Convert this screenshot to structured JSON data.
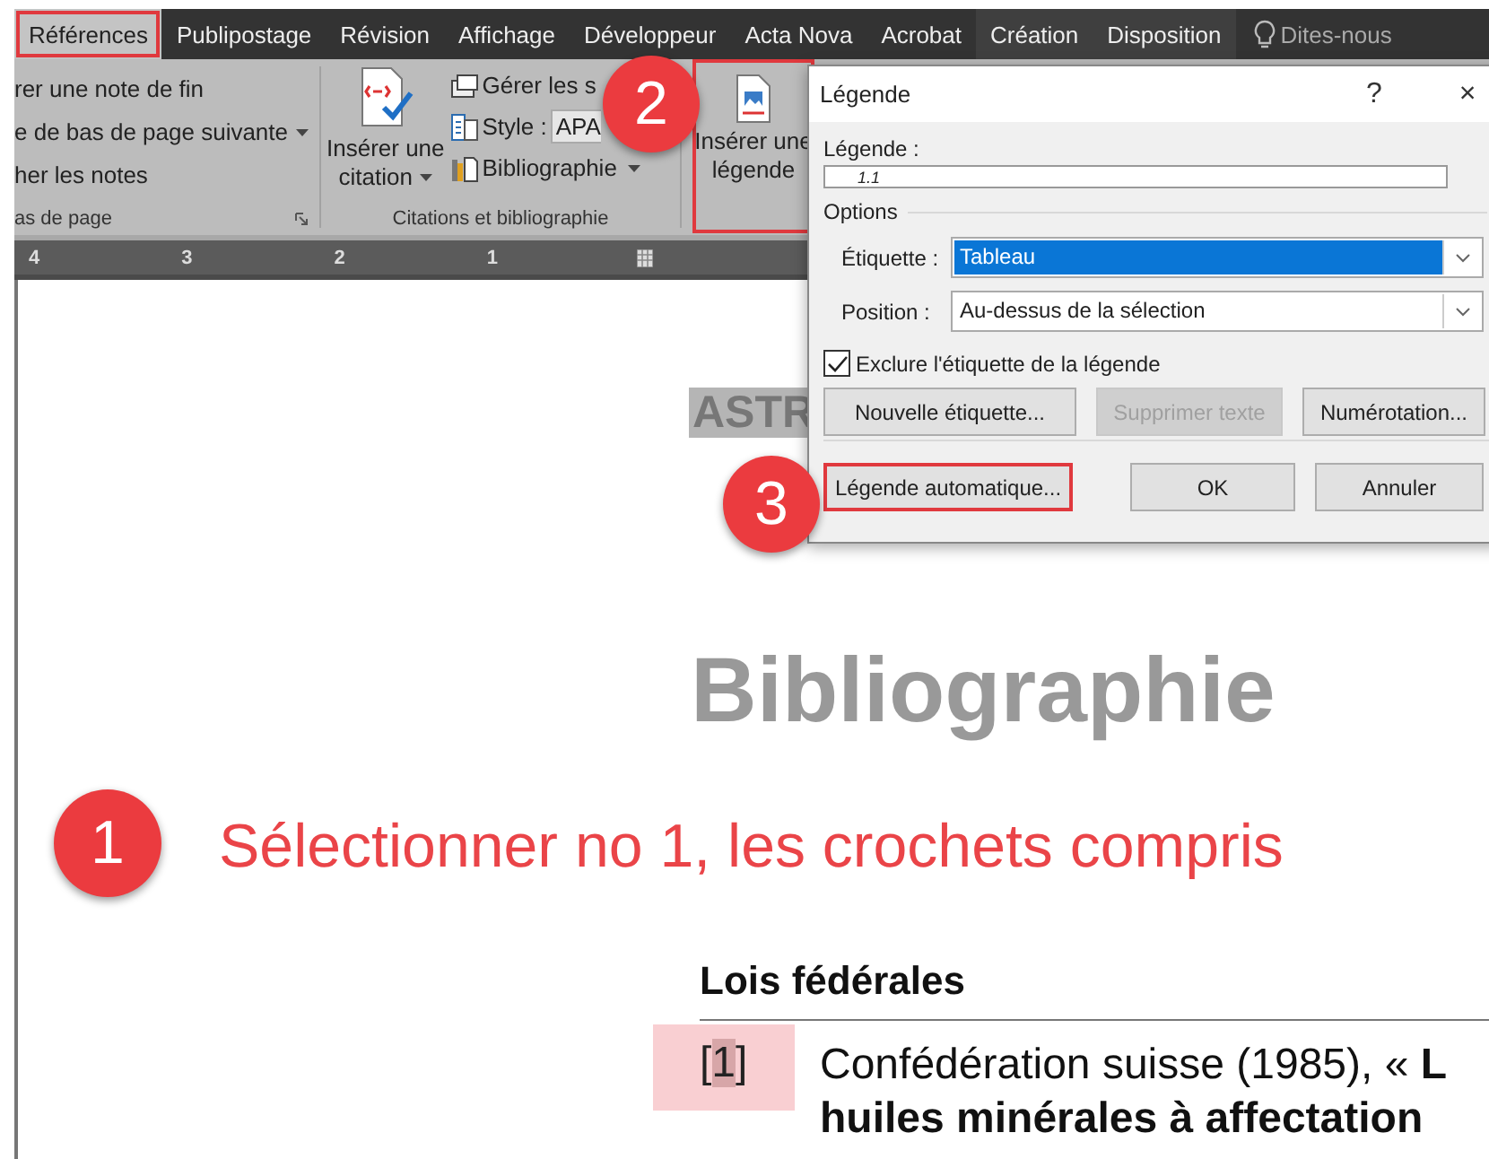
{
  "ribbon_tabs": [
    {
      "label": "Références",
      "selected": true,
      "outlined": true,
      "contextual": false
    },
    {
      "label": "Publipostage",
      "selected": false,
      "outlined": false,
      "contextual": false
    },
    {
      "label": "Révision",
      "selected": false,
      "outlined": false,
      "contextual": false
    },
    {
      "label": "Affichage",
      "selected": false,
      "outlined": false,
      "contextual": false
    },
    {
      "label": "Développeur",
      "selected": false,
      "outlined": false,
      "contextual": false
    },
    {
      "label": "Acta Nova",
      "selected": false,
      "outlined": false,
      "contextual": false
    },
    {
      "label": "Acrobat",
      "selected": false,
      "outlined": false,
      "contextual": false
    },
    {
      "label": "Création",
      "selected": false,
      "outlined": false,
      "contextual": true
    },
    {
      "label": "Disposition",
      "selected": false,
      "outlined": false,
      "contextual": true
    }
  ],
  "tell_me": {
    "text": "Dites-nous"
  },
  "ribbon": {
    "notes_group": {
      "items": [
        {
          "label": "rer une note de fin",
          "dropdown": false
        },
        {
          "label": "e de bas de page suivante",
          "dropdown": true
        },
        {
          "label": "her les notes",
          "dropdown": false
        }
      ],
      "label": "as de page"
    },
    "citations_group": {
      "insert_citation": [
        "Insérer une",
        "citation"
      ],
      "manage_sources": "Gérer les s",
      "style_label": "Style :",
      "style_value": "APA",
      "bibliography": "Bibliographie",
      "label": "Citations et bibliographie"
    },
    "insert_caption": {
      "lines": [
        "Insérer une",
        "légende"
      ],
      "outlined": true
    }
  },
  "ruler": {
    "labels": [
      "4",
      "3",
      "2",
      "1"
    ]
  },
  "document": {
    "heading": "ASTR",
    "title": "Bibliographie",
    "instruction": "Sélectionner no 1, les crochets compris",
    "section": "Lois fédérales",
    "entry": {
      "bracket_open": "[",
      "number": "1",
      "bracket_close": "]",
      "line_1": "Confédération suisse (1985), « **L**",
      "line_2": "huiles minérales à affectation"
    }
  },
  "dialog": {
    "title": "Légende",
    "help": "?",
    "close": "×",
    "caption_label": "Légende :",
    "caption_value": "1.1",
    "options_label": "Options",
    "fields": [
      {
        "label": "Étiquette :",
        "value": "Tableau",
        "highlighted": true
      },
      {
        "label": "Position :",
        "value": "Au-dessus de la sélection",
        "highlighted": false
      }
    ],
    "exclude": {
      "label": "Exclure l'étiquette de la légende",
      "checked": true
    },
    "row_buttons": [
      {
        "label": "Nouvelle étiquette...",
        "disabled": false
      },
      {
        "label": "Supprimer texte",
        "disabled": true
      },
      {
        "label": "Numérotation...",
        "disabled": false
      }
    ],
    "bottom_buttons": [
      {
        "label": "Légende automatique...",
        "outlined": true
      },
      {
        "label": "OK",
        "outlined": false
      },
      {
        "label": "Annuler",
        "outlined": false
      }
    ]
  },
  "callouts": [
    {
      "number": "2"
    },
    {
      "number": "3"
    },
    {
      "number": "1"
    }
  ]
}
